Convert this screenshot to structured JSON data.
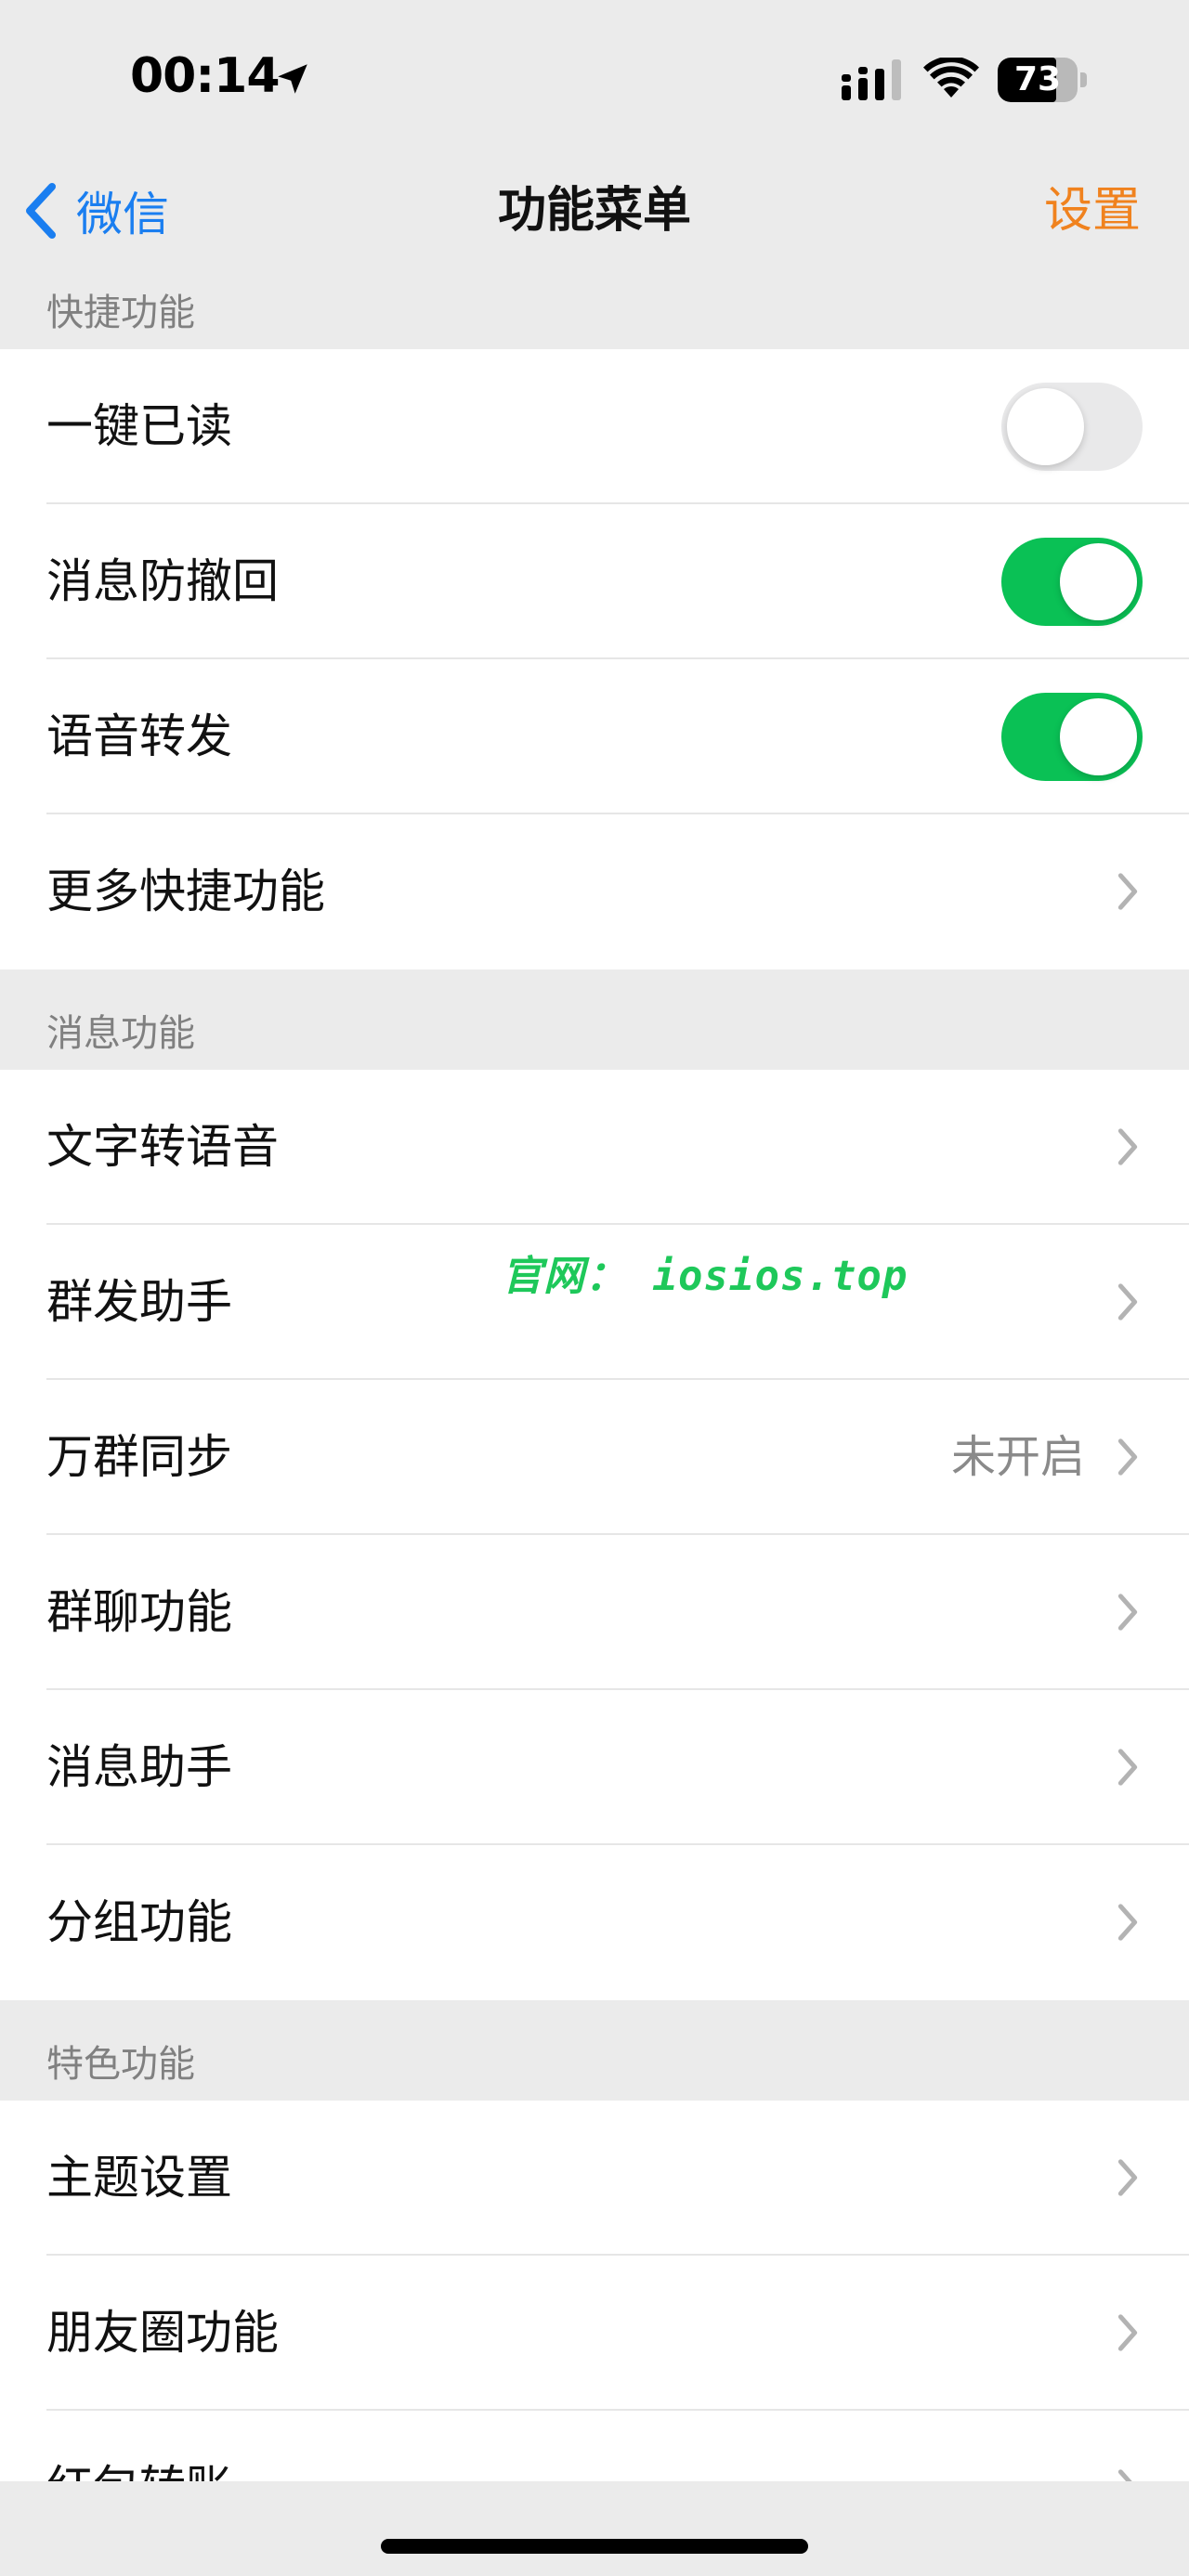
{
  "status_bar": {
    "time": "00:14",
    "battery_level": "73",
    "battery_fraction": 0.73,
    "icons": [
      "location-arrow-icon",
      "cellular-signal-icon",
      "wifi-icon",
      "battery-icon"
    ]
  },
  "nav": {
    "back_label": "微信",
    "title": "功能菜单",
    "right_action": "设置"
  },
  "sections": [
    {
      "header": "快捷功能",
      "rows": [
        {
          "label": "一键已读",
          "type": "toggle",
          "on": false
        },
        {
          "label": "消息防撤回",
          "type": "toggle",
          "on": true
        },
        {
          "label": "语音转发",
          "type": "toggle",
          "on": true
        },
        {
          "label": "更多快捷功能",
          "type": "chevron"
        }
      ]
    },
    {
      "header": "消息功能",
      "rows": [
        {
          "label": "文字转语音",
          "type": "chevron"
        },
        {
          "label": "群发助手",
          "type": "chevron"
        },
        {
          "label": "万群同步",
          "type": "chevron",
          "value": "未开启"
        },
        {
          "label": "群聊功能",
          "type": "chevron"
        },
        {
          "label": "消息助手",
          "type": "chevron"
        },
        {
          "label": "分组功能",
          "type": "chevron"
        }
      ]
    },
    {
      "header": "特色功能",
      "rows": [
        {
          "label": "主题设置",
          "type": "chevron"
        },
        {
          "label": "朋友圈功能",
          "type": "chevron"
        },
        {
          "label": "红包转账",
          "type": "chevron"
        }
      ]
    }
  ],
  "watermark": "官网： iosios.top",
  "colors": {
    "accent_blue": "#1a7ef0",
    "accent_orange": "#f0821e",
    "toggle_on": "#0ac155",
    "toggle_off": "#e9e9ea",
    "watermark_green": "#1ec85a",
    "background": "#ebebeb"
  }
}
